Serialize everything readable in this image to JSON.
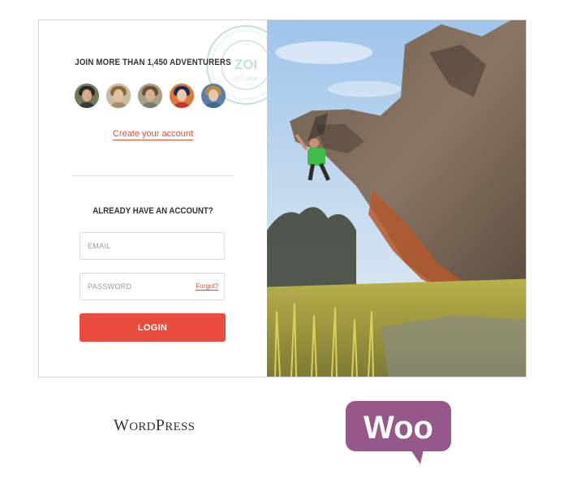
{
  "signup": {
    "title": "JOIN MORE THAN 1,450 ADVENTURERS",
    "avatars": [
      "member-1",
      "member-2",
      "member-3",
      "member-4",
      "member-5"
    ],
    "create_link": "Create your account"
  },
  "login": {
    "title": "ALREADY HAVE AN ACCOUNT?",
    "email_placeholder": "EMAIL",
    "email_value": "",
    "password_placeholder": "PASSWORD",
    "password_value": "",
    "forgot_label": "Forgot?",
    "submit_label": "LOGIN"
  },
  "stamp": {
    "brand": "ZOI",
    "est": "EST. 2014"
  },
  "logos": {
    "wordpress": {
      "big_w": "W",
      "rest_w": "ORD",
      "big_p": "P",
      "rest_p": "RESS"
    },
    "woo": "Woo"
  },
  "colors": {
    "accent": "#e84c3d",
    "link": "#e24c3f",
    "woo_purple": "#96588a",
    "stamp": "#8fc9bf"
  },
  "icons": {
    "hero": "rock-climber-photo"
  }
}
